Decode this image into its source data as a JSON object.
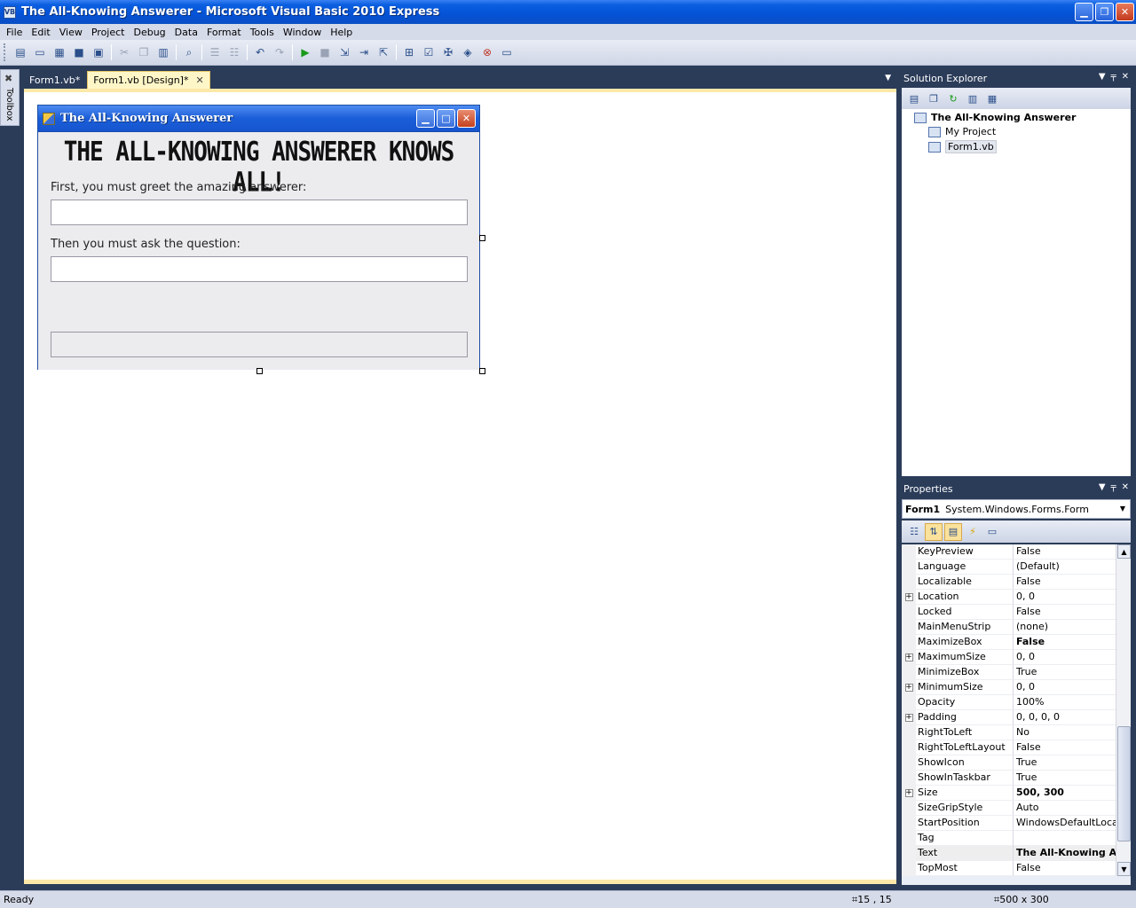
{
  "window": {
    "title": "The All-Knowing Answerer - Microsoft Visual Basic 2010 Express",
    "app_icon": "VB",
    "min_icon": "▁",
    "restore_icon": "❐",
    "close_icon": "✕"
  },
  "menu": [
    "File",
    "Edit",
    "View",
    "Project",
    "Debug",
    "Data",
    "Format",
    "Tools",
    "Window",
    "Help"
  ],
  "toolbar": {
    "icons": [
      "new-project",
      "open-file",
      "add-item",
      "save",
      "save-all",
      "cut",
      "copy",
      "paste",
      "find",
      "comment",
      "uncomment",
      "undo",
      "redo",
      "start-debugging",
      "stop",
      "step-into",
      "step-over",
      "step-out",
      "solution-explorer",
      "properties-window",
      "toolbox",
      "object-browser",
      "error-list",
      "start-page"
    ]
  },
  "toolbox": {
    "label": "Toolbox"
  },
  "tabs": [
    {
      "label": "Form1.vb*",
      "active": false
    },
    {
      "label": "Form1.vb [Design]*",
      "active": true
    }
  ],
  "designer_form": {
    "title": "The All-Knowing Answerer",
    "headline": "THE ALL-KNOWING ANSWERER KNOWS ALL!",
    "greet_label": "First, you must greet the amazing answerer:",
    "question_label": "Then you must ask the question:"
  },
  "solution_explorer": {
    "title": "Solution Explorer",
    "root": "The All-Knowing Answerer",
    "items": [
      "My Project",
      "Form1.vb"
    ]
  },
  "properties": {
    "title": "Properties",
    "object_name": "Form1",
    "object_type": "System.Windows.Forms.Form",
    "rows": [
      {
        "name": "KeyPreview",
        "value": "False",
        "expandable": false,
        "bold": false
      },
      {
        "name": "Language",
        "value": "(Default)",
        "expandable": false,
        "bold": false
      },
      {
        "name": "Localizable",
        "value": "False",
        "expandable": false,
        "bold": false
      },
      {
        "name": "Location",
        "value": "0, 0",
        "expandable": true,
        "bold": false
      },
      {
        "name": "Locked",
        "value": "False",
        "expandable": false,
        "bold": false
      },
      {
        "name": "MainMenuStrip",
        "value": "(none)",
        "expandable": false,
        "bold": false
      },
      {
        "name": "MaximizeBox",
        "value": "False",
        "expandable": false,
        "bold": true
      },
      {
        "name": "MaximumSize",
        "value": "0, 0",
        "expandable": true,
        "bold": false
      },
      {
        "name": "MinimizeBox",
        "value": "True",
        "expandable": false,
        "bold": false
      },
      {
        "name": "MinimumSize",
        "value": "0, 0",
        "expandable": true,
        "bold": false
      },
      {
        "name": "Opacity",
        "value": "100%",
        "expandable": false,
        "bold": false
      },
      {
        "name": "Padding",
        "value": "0, 0, 0, 0",
        "expandable": true,
        "bold": false
      },
      {
        "name": "RightToLeft",
        "value": "No",
        "expandable": false,
        "bold": false
      },
      {
        "name": "RightToLeftLayout",
        "value": "False",
        "expandable": false,
        "bold": false
      },
      {
        "name": "ShowIcon",
        "value": "True",
        "expandable": false,
        "bold": false
      },
      {
        "name": "ShowInTaskbar",
        "value": "True",
        "expandable": false,
        "bold": false
      },
      {
        "name": "Size",
        "value": "500, 300",
        "expandable": true,
        "bold": true
      },
      {
        "name": "SizeGripStyle",
        "value": "Auto",
        "expandable": false,
        "bold": false
      },
      {
        "name": "StartPosition",
        "value": "WindowsDefaultLocation",
        "expandable": false,
        "bold": false
      },
      {
        "name": "Tag",
        "value": "",
        "expandable": false,
        "bold": false
      },
      {
        "name": "Text",
        "value": "The All-Knowing Answerer",
        "expandable": false,
        "bold": true,
        "highlight": true
      },
      {
        "name": "TopMost",
        "value": "False",
        "expandable": false,
        "bold": false
      }
    ]
  },
  "status": {
    "ready": "Ready",
    "position": "15 , 15",
    "size": "500 x 300"
  },
  "colors": {
    "titlebar": "#0552d6",
    "ide_background": "#2b3c59",
    "active_tab": "#fff6c8"
  }
}
